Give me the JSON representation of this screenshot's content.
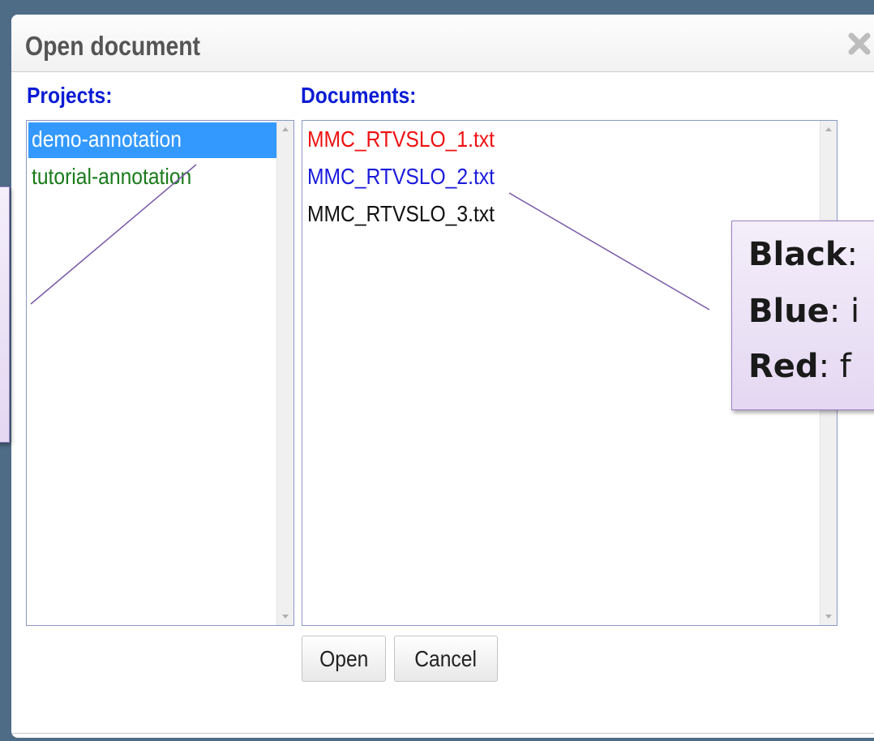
{
  "dialog": {
    "title": "Open document",
    "close_icon": "close-icon"
  },
  "projects": {
    "label": "Projects:",
    "items": [
      {
        "label": "demo-annotation",
        "selected": true,
        "color": "#ffffff"
      },
      {
        "label": "tutorial-annotation",
        "selected": false,
        "color": "#1a7a1a"
      }
    ]
  },
  "documents": {
    "label": "Documents:",
    "items": [
      {
        "label": "MMC_RTVSLO_1.txt",
        "color": "#ee1111"
      },
      {
        "label": "MMC_RTVSLO_2.txt",
        "color": "#1a1adc"
      },
      {
        "label": "MMC_RTVSLO_3.txt",
        "color": "#111111"
      }
    ]
  },
  "buttons": {
    "open": "Open",
    "cancel": "Cancel"
  },
  "legend_callout": {
    "lines": [
      {
        "key": "Black",
        "sep": ":"
      },
      {
        "key": "Blue",
        "sep": ": i"
      },
      {
        "key": "Red",
        "sep": ": f"
      }
    ]
  },
  "colors": {
    "heading_blue": "#0a1cd4",
    "selection": "#3399ff",
    "callout_fill": "#e9def5",
    "callout_border": "#9b83c4"
  }
}
